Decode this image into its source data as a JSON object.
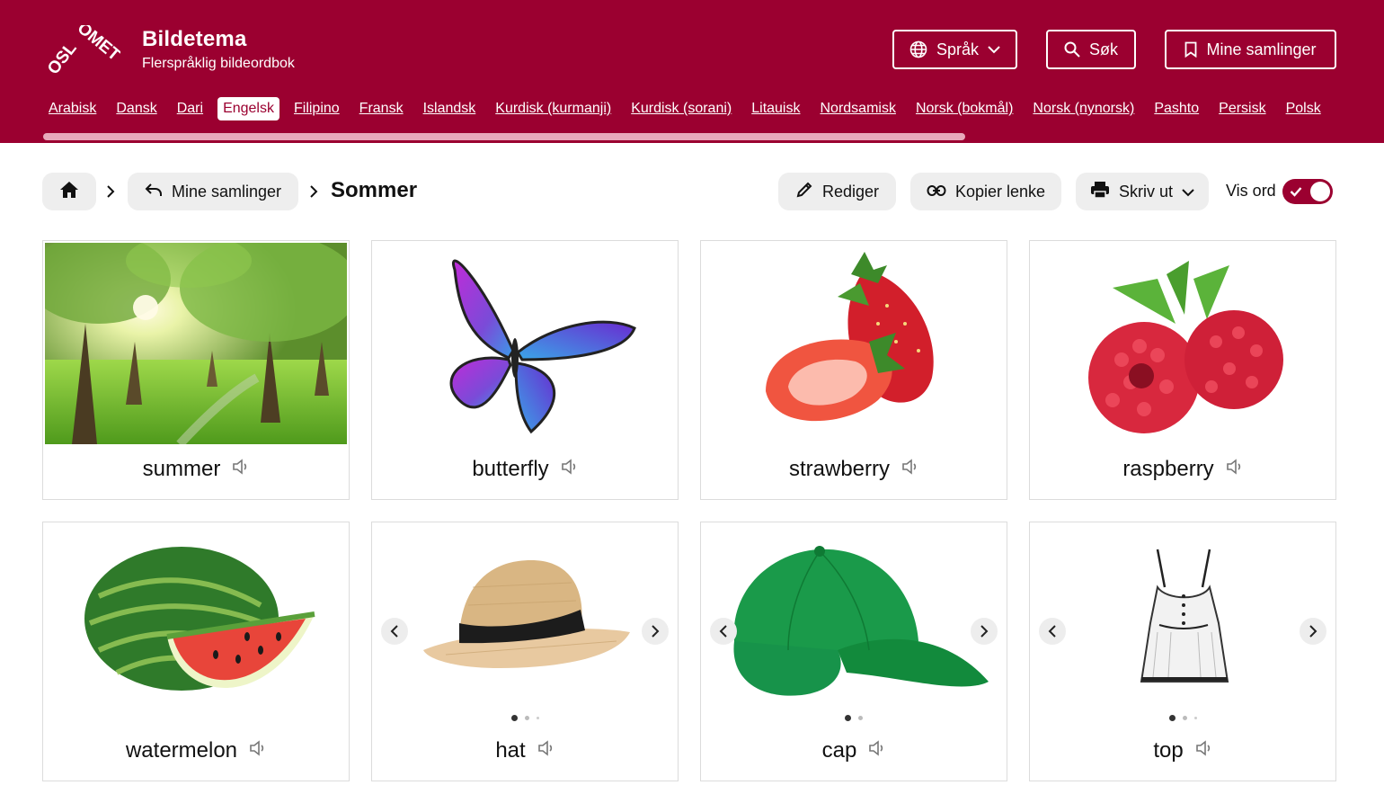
{
  "header": {
    "logo_text": "OSLOMET",
    "title": "Bildetema",
    "subtitle": "Flerspråklig bildeordbok",
    "language_button": "Språk",
    "search_button": "Søk",
    "collections_button": "Mine samlinger",
    "brand_color": "#9b0030"
  },
  "languages": [
    {
      "label": "Arabisk"
    },
    {
      "label": "Dansk"
    },
    {
      "label": "Dari"
    },
    {
      "label": "Engelsk",
      "active": true
    },
    {
      "label": "Filipino"
    },
    {
      "label": "Fransk"
    },
    {
      "label": "Islandsk"
    },
    {
      "label": "Kurdisk (kurmanji)"
    },
    {
      "label": "Kurdisk (sorani)"
    },
    {
      "label": "Litauisk"
    },
    {
      "label": "Nordsamisk"
    },
    {
      "label": "Norsk (bokmål)"
    },
    {
      "label": "Norsk (nynorsk)"
    },
    {
      "label": "Pashto"
    },
    {
      "label": "Persisk"
    },
    {
      "label": "Polsk"
    }
  ],
  "breadcrumb": {
    "collections": "Mine samlinger",
    "current": "Sommer"
  },
  "toolbar": {
    "edit": "Rediger",
    "copy_link": "Kopier lenke",
    "print": "Skriv ut",
    "show_words": "Vis ord",
    "show_words_on": true
  },
  "cards": [
    {
      "word": "summer",
      "image": "sunlit-orchard-trees",
      "carousel": false
    },
    {
      "word": "butterfly",
      "image": "purple-blue-butterfly",
      "carousel": false
    },
    {
      "word": "strawberry",
      "image": "strawberries",
      "carousel": false
    },
    {
      "word": "raspberry",
      "image": "raspberries",
      "carousel": false
    },
    {
      "word": "watermelon",
      "image": "watermelon-slice",
      "carousel": false
    },
    {
      "word": "hat",
      "image": "straw-hat",
      "carousel": true,
      "slides": 3
    },
    {
      "word": "cap",
      "image": "green-baseball-cap",
      "carousel": true,
      "slides": 2
    },
    {
      "word": "top",
      "image": "white-tank-top",
      "carousel": true,
      "slides": 3
    }
  ]
}
